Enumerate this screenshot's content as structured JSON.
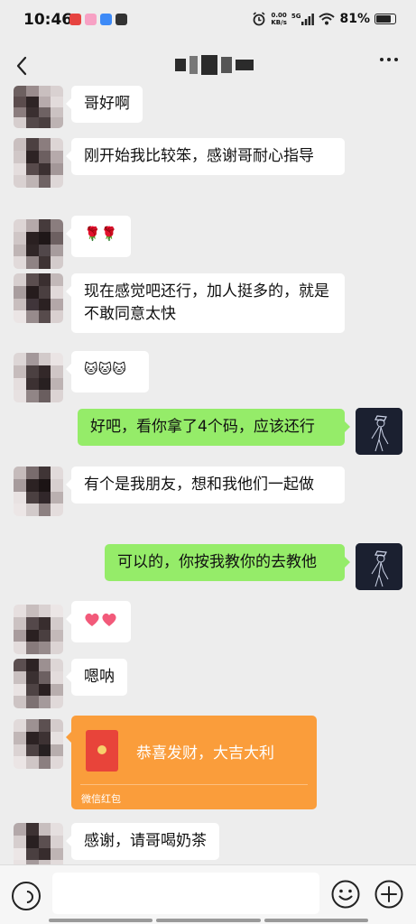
{
  "status_bar": {
    "time": "10:46",
    "net_speed_value": "0.00",
    "net_speed_unit": "KB/s",
    "network": "5G",
    "battery": "81%",
    "battery_level": 0.81
  },
  "header": {
    "title": "",
    "back_icon": "chevron-left-icon",
    "more_icon": "ellipsis-icon"
  },
  "messages": [
    {
      "side": "in",
      "text": "哥好啊"
    },
    {
      "side": "in",
      "text": "刚开始我比较笨，感谢哥耐心指导"
    },
    {
      "side": "in",
      "text": "🌹🌹"
    },
    {
      "side": "in",
      "text": "现在感觉吧还行，加人挺多的，就是不敢同意太快"
    },
    {
      "side": "in",
      "text": "🐱🐱🐱"
    },
    {
      "side": "out",
      "text": "好吧，看你拿了4个码，应该还行"
    },
    {
      "side": "in",
      "text": "有个是我朋友，想和我他们一起做"
    },
    {
      "side": "out",
      "text": "可以的，你按我教你的去教他"
    },
    {
      "side": "in",
      "text": "💕"
    },
    {
      "side": "in",
      "text": "嗯呐"
    },
    {
      "side": "in",
      "type": "red_packet",
      "text": "恭喜发财，大吉大利",
      "label": "微信红包"
    },
    {
      "side": "in",
      "text": "感谢，请哥喝奶茶"
    }
  ],
  "input_bar": {
    "placeholder": "",
    "voice_icon": "voice-icon",
    "emoji_icon": "emoji-icon",
    "plus_icon": "plus-icon"
  },
  "colors": {
    "background": "#ededed",
    "incoming_bubble": "#ffffff",
    "outgoing_bubble": "#95ec69",
    "red_packet": "#fa9d3b"
  }
}
